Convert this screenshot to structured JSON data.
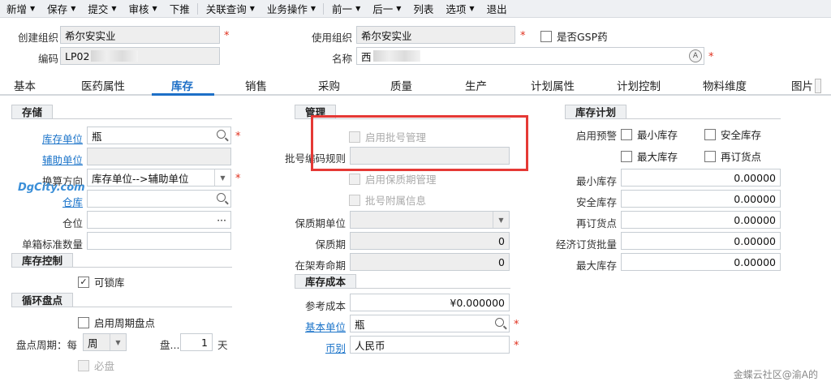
{
  "toolbar": {
    "items": [
      {
        "label": "新增",
        "caret": true
      },
      {
        "label": "保存",
        "caret": true
      },
      {
        "label": "提交",
        "caret": true
      },
      {
        "label": "审核",
        "caret": true
      },
      {
        "label": "下推",
        "caret": false
      },
      {
        "label": "关联查询",
        "caret": true
      },
      {
        "label": "业务操作",
        "caret": true
      },
      {
        "label": "前一",
        "caret": true
      },
      {
        "label": "后一",
        "caret": true
      },
      {
        "label": "列表",
        "caret": false
      },
      {
        "label": "选项",
        "caret": true
      },
      {
        "label": "退出",
        "caret": false
      }
    ]
  },
  "header": {
    "create_org_label": "创建组织",
    "create_org_value": "希尔安实业",
    "use_org_label": "使用组织",
    "use_org_value": "希尔安实业",
    "gsp_label": "是否GSP药",
    "code_label": "编码",
    "code_value": "LP02",
    "name_label": "名称",
    "name_value": "西"
  },
  "tabs": [
    "基本",
    "医药属性",
    "库存",
    "销售",
    "采购",
    "质量",
    "生产",
    "计划属性",
    "计划控制",
    "物料维度",
    "图片"
  ],
  "storage": {
    "title": "存储",
    "stock_unit_label": "库存单位",
    "stock_unit_value": "瓶",
    "aux_unit_label": "辅助单位",
    "conv_dir_label": "换算方向",
    "conv_dir_value": "库存单位-->辅助单位",
    "warehouse_label": "仓库",
    "location_label": "仓位",
    "location_value": "···",
    "box_qty_label": "单箱标准数量"
  },
  "stock_control": {
    "title": "库存控制",
    "lockable_label": "可锁库",
    "lockable_checked": true
  },
  "cycle_count": {
    "title": "循环盘点",
    "enable_label": "启用周期盘点",
    "period_label": "盘点周期：每",
    "period_unit_value": "周",
    "count_label": "盘...",
    "count_value": "1",
    "day_label": "天",
    "must_label": "必盘"
  },
  "manage": {
    "title": "管理",
    "batch_label": "启用批号管理",
    "batch_rule_label": "批号编码规则",
    "shelf_label": "启用保质期管理",
    "batch_attach_label": "批号附属信息",
    "shelf_unit_label": "保质期单位",
    "shelf_life_label": "保质期",
    "shelf_life_value": "0",
    "on_shelf_label": "在架寿命期",
    "on_shelf_value": "0"
  },
  "cost": {
    "title": "库存成本",
    "ref_cost_label": "参考成本",
    "ref_cost_value": "¥0.000000",
    "base_unit_label": "基本单位",
    "base_unit_value": "瓶",
    "currency_label": "币别",
    "currency_value": "人民币"
  },
  "plan": {
    "title": "库存计划",
    "alert_label": "启用预警",
    "min_stock_cb": "最小库存",
    "safe_stock_cb": "安全库存",
    "max_stock_cb": "最大库存",
    "reorder_cb": "再订货点",
    "fields": [
      {
        "label": "最小库存",
        "value": "0.00000"
      },
      {
        "label": "安全库存",
        "value": "0.00000"
      },
      {
        "label": "再订货点",
        "value": "0.00000"
      },
      {
        "label": "经济订货批量",
        "value": "0.00000"
      },
      {
        "label": "最大库存",
        "value": "0.00000"
      }
    ]
  },
  "watermark": {
    "logo": "DgCity.com",
    "footer": "金蝶云社区@渝A的"
  },
  "colors": {
    "accent": "#1d6fc7",
    "required": "#e0301e",
    "highlight_box": "#e53935"
  }
}
